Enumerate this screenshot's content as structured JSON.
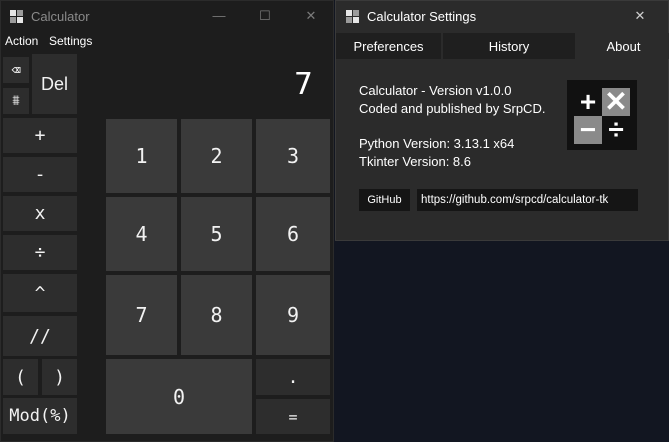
{
  "calculator": {
    "title": "Calculator",
    "controls": {
      "minimize": "—",
      "maximize": "☐",
      "close": "✕"
    },
    "menu": [
      "Action",
      "Settings"
    ],
    "display": "7",
    "buttons": {
      "backspace": "⌫",
      "sqrt": "⩩",
      "del": "Del",
      "plus": "+",
      "minus": "-",
      "multiply": "x",
      "divide": "÷",
      "power": "^",
      "floordiv": "//",
      "lparen": "(",
      "rparen": ")",
      "mod": "Mod(%)",
      "n1": "1",
      "n2": "2",
      "n3": "3",
      "n4": "4",
      "n5": "5",
      "n6": "6",
      "n7": "7",
      "n8": "8",
      "n9": "9",
      "n0": "0",
      "dot": ".",
      "equals": "="
    }
  },
  "settings": {
    "title": "Calculator Settings",
    "controls": {
      "close": "✕"
    },
    "tabs": [
      {
        "label": "Preferences",
        "active": false
      },
      {
        "label": "History",
        "active": false
      },
      {
        "label": "About",
        "active": true
      }
    ],
    "about": {
      "version": "Calculator - Version v1.0.0",
      "credits": "Coded and published by SrpCD.",
      "python": "Python Version: 3.13.1 x64",
      "tkinter": "Tkinter Version: 8.6"
    },
    "github_label": "GitHub",
    "github_url": "https://github.com/srpcd/calculator-tk"
  },
  "colors": {
    "background": "#121621",
    "calc_window": "#1d1d1d",
    "settings_window": "#2b2b2b",
    "button": "#2d2d2d",
    "number_button": "#3a3a3a"
  }
}
